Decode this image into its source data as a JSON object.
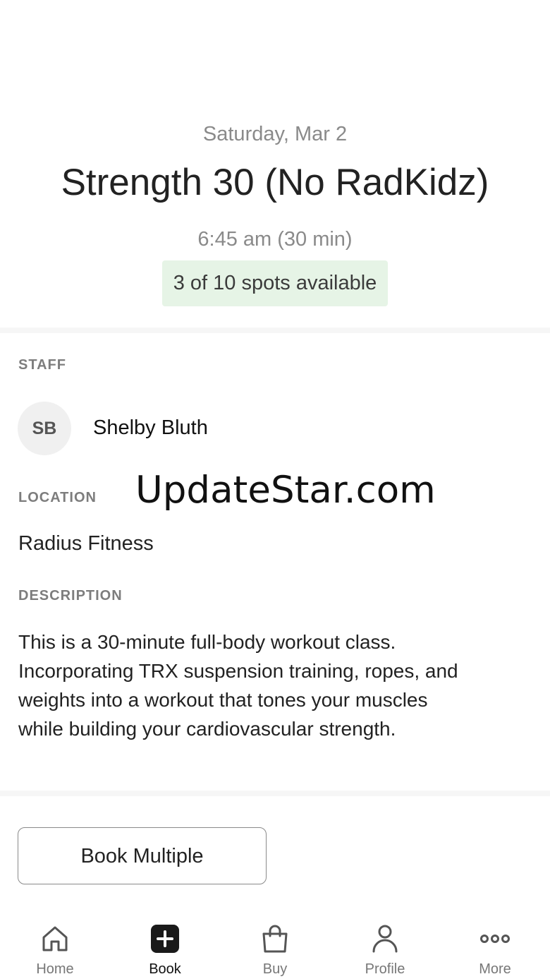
{
  "class": {
    "date": "Saturday, Mar 2",
    "title": "Strength 30 (No RadKidz)",
    "time": "6:45 am (30 min)",
    "spots": "3 of 10 spots available"
  },
  "staff": {
    "label": "STAFF",
    "initials": "SB",
    "name": "Shelby Bluth"
  },
  "location": {
    "label": "LOCATION",
    "name": "Radius Fitness"
  },
  "watermark": "UpdateStar.com",
  "description": {
    "label": "DESCRIPTION",
    "lines": [
      "This is a 30-minute full-body workout class.",
      "Incorporating TRX suspension training, ropes, and",
      "weights into a workout that tones your muscles",
      "while building your cardiovascular strength."
    ]
  },
  "actions": {
    "book_multiple": "Book Multiple"
  },
  "tabbar": {
    "items": [
      {
        "label": "Home",
        "icon": "home-icon",
        "active": false
      },
      {
        "label": "Book",
        "icon": "plus-square-icon",
        "active": true
      },
      {
        "label": "Buy",
        "icon": "shopping-bag-icon",
        "active": false
      },
      {
        "label": "Profile",
        "icon": "person-icon",
        "active": false
      },
      {
        "label": "More",
        "icon": "more-dots-icon",
        "active": false
      }
    ]
  },
  "colors": {
    "spots_background": "#e6f4e6",
    "active_tab": "#111111",
    "inactive_tab": "#777777"
  }
}
